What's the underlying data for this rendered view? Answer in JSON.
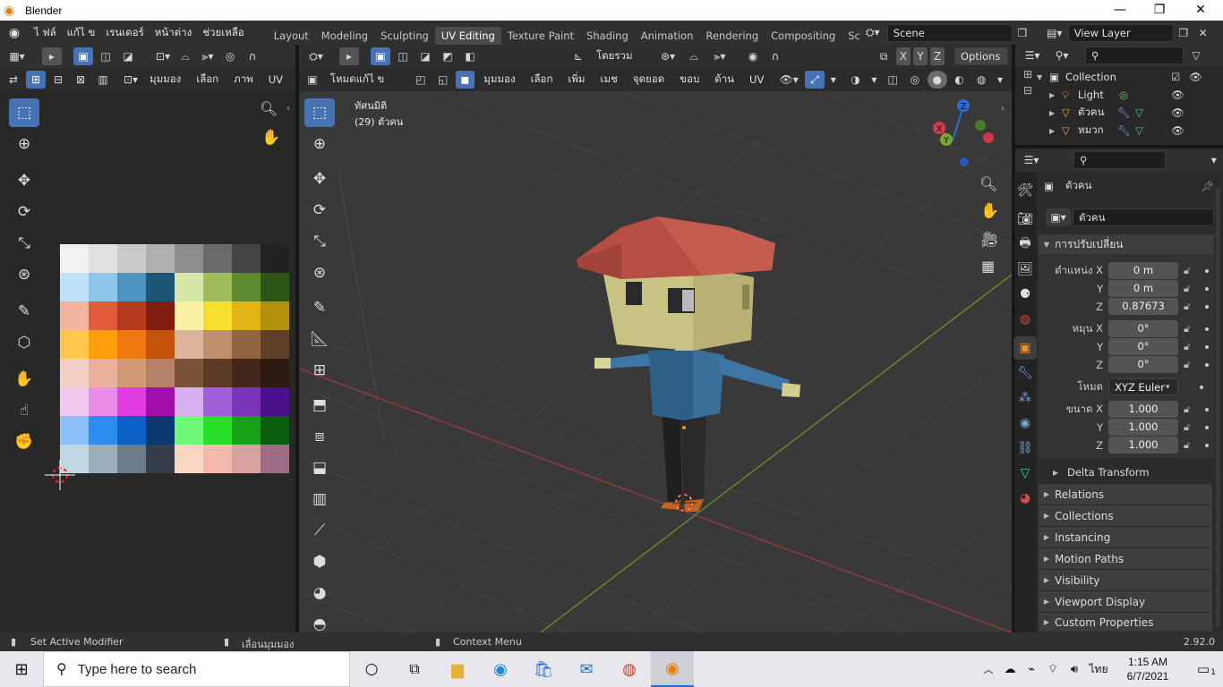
{
  "window": {
    "title": "Blender",
    "min": "—",
    "max": "❐",
    "close": "✕"
  },
  "menu": {
    "file": "ไ ฟล์",
    "edit": "แก้ไ ข",
    "render": "เรนเดอร์",
    "window": "หน้าต่าง",
    "help": "ช่วยเหลือ"
  },
  "workspaces": [
    "Layout",
    "Modeling",
    "Sculpting",
    "UV Editing",
    "Texture Paint",
    "Shading",
    "Animation",
    "Rendering",
    "Compositing",
    "Scriptin"
  ],
  "active_workspace": "UV Editing",
  "scene": {
    "name": "Scene",
    "view_layer": "View Layer"
  },
  "uv_editor": {
    "menus": [
      "มุมมอง",
      "เลือก",
      "ภาพ",
      "UV"
    ],
    "palette": [
      [
        "#f2f2f2",
        "#e0e0e0",
        "#cacaca",
        "#b0b0b0",
        "#8e8e8e",
        "#6a6a6a",
        "#444444",
        "#222222"
      ],
      [
        "#bfe3f8",
        "#8ec7e9",
        "#4d94c0",
        "#1d5577",
        "#d6e8a8",
        "#9fbd5c",
        "#5e8a30",
        "#2f5418"
      ],
      [
        "#f4b5a0",
        "#e05c3b",
        "#b53a1e",
        "#7e1d10",
        "#fbf1a4",
        "#f7df2d",
        "#e1b315",
        "#b2900c"
      ],
      [
        "#ffc84d",
        "#ff9d0a",
        "#f07810",
        "#c45208",
        "#dcb49c",
        "#c0906e",
        "#8f6440",
        "#5f4026"
      ],
      [
        "#f4cfc4",
        "#e9b09e",
        "#d39a78",
        "#b5826a",
        "#7a5238",
        "#5c3a28",
        "#41271c",
        "#2b1a12"
      ],
      [
        "#f0c8f0",
        "#e88ce8",
        "#e03ce0",
        "#a010a8",
        "#d8b0f0",
        "#a060d8",
        "#7a34b8",
        "#4a1088"
      ],
      [
        "#8cc0f8",
        "#2c8cf0",
        "#0c60c8",
        "#0a3870",
        "#70f878",
        "#28e028",
        "#18a018",
        "#0c5c10"
      ],
      [
        "#c0d8e4",
        "#9cb0bc",
        "#6c7c88",
        "#343e48",
        "#fcd6c4",
        "#f4b8ac",
        "#d8a0a0",
        "#9c6c84"
      ]
    ]
  },
  "viewport": {
    "mode": "โหมดแก้ไ ข",
    "menus": [
      "มุมมอง",
      "เลือก",
      "เพิ่ม",
      "เมช",
      "จุดยอด",
      "ขอบ",
      "ด้าน",
      "UV"
    ],
    "transform": "โดยรวม",
    "options": "Options",
    "view_name": "ทัศนมิติ",
    "object_info": "(29) ตัวคน",
    "axes": [
      "X",
      "Y",
      "Z"
    ]
  },
  "outliner": {
    "collection": "Collection",
    "items": [
      {
        "name": "Light",
        "icon": "light-icon"
      },
      {
        "name": "ตัวคน",
        "icon": "mesh-icon"
      },
      {
        "name": "หมวก",
        "icon": "mesh-icon"
      }
    ]
  },
  "properties": {
    "object_name": "ตัวคน",
    "object_field": "ตัวคน",
    "transform_title": "การปรับเปลี่ยน",
    "location": {
      "label_x": "ตำแหน่ง X",
      "x": "0 m",
      "y": "0 m",
      "z": "0.87673"
    },
    "rotation": {
      "label_x": "หมุน X",
      "x": "0°",
      "y": "0°",
      "z": "0°"
    },
    "mode_label": "โหมด",
    "mode_value": "XYZ Euler",
    "scale": {
      "label_x": "ขนาด X",
      "x": "1.000",
      "y": "1.000",
      "z": "1.000"
    },
    "y": "Y",
    "z": "Z",
    "delta": "Delta Transform",
    "sections": [
      "Relations",
      "Collections",
      "Instancing",
      "Motion Paths",
      "Visibility",
      "Viewport Display",
      "Custom Properties"
    ]
  },
  "status": {
    "left": "Set Active Modifier",
    "middle": "เลื่อนมุมมอง",
    "right": "Context Menu",
    "version": "2.92.0"
  },
  "taskbar": {
    "search_placeholder": "Type here to search",
    "lang": "ไทย",
    "time": "1:15 AM",
    "date": "6/7/2021",
    "notifications": "1"
  },
  "colors": {
    "accent": "#4772b3",
    "x_axis": "#d03d4a",
    "y_axis": "#7aa531",
    "z_axis": "#2b6bd0"
  }
}
